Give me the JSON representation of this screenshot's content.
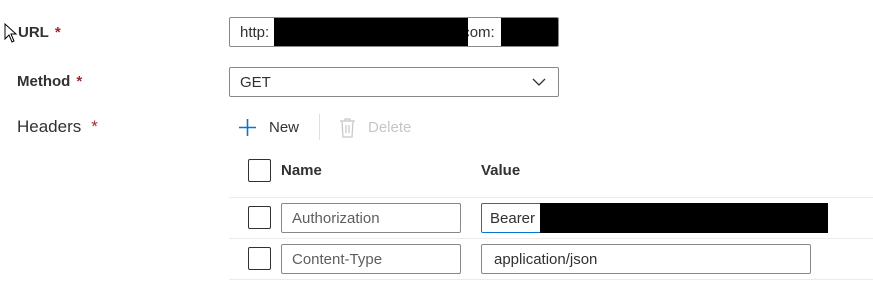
{
  "form": {
    "url": {
      "label": "URL",
      "required_mark": "*",
      "value_prefix": "http:",
      "value_suffix": "com:"
    },
    "method": {
      "label": "Method",
      "required_mark": "*",
      "selected": "GET"
    },
    "headers": {
      "label": "Headers",
      "required_mark": "*",
      "toolbar": {
        "new_label": "New",
        "delete_label": "Delete"
      },
      "columns": {
        "name": "Name",
        "value": "Value"
      },
      "rows": [
        {
          "name_placeholder": "Authorization",
          "value": "Bearer"
        },
        {
          "name_placeholder": "Content-Type",
          "value": "application/json"
        }
      ]
    }
  },
  "colors": {
    "accent": "#0078d4",
    "required": "#a4262c",
    "disabled": "#c8c6c4"
  }
}
